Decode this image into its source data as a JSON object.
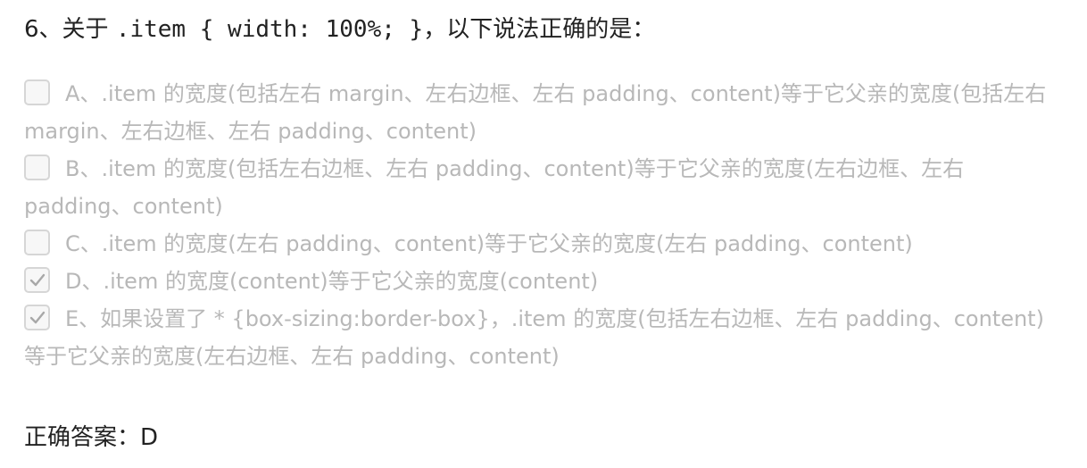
{
  "question": {
    "prefix": "6、关于 ",
    "code": ".item { width: 100%; }",
    "suffix": "，以下说法正确的是："
  },
  "options": [
    {
      "checked": false,
      "text": "A、.item 的宽度(包括左右 margin、左右边框、左右 padding、content)等于它父亲的宽度(包括左右 margin、左右边框、左右 padding、content)"
    },
    {
      "checked": false,
      "text": "B、.item 的宽度(包括左右边框、左右 padding、content)等于它父亲的宽度(左右边框、左右 padding、content)"
    },
    {
      "checked": false,
      "text": "C、.item 的宽度(左右 padding、content)等于它父亲的宽度(左右 padding、content)"
    },
    {
      "checked": true,
      "text": "D、.item 的宽度(content)等于它父亲的宽度(content)"
    },
    {
      "checked": true,
      "text": "E、如果设置了 * {box-sizing:border-box}，.item 的宽度(包括左右边框、左右 padding、content)等于它父亲的宽度(左右边框、左右 padding、content)"
    }
  ],
  "answer": {
    "label": "正确答案：D"
  },
  "colors": {
    "question_text": "#222222",
    "option_text": "#b8b8b8",
    "checkbox_border": "#d6d6d6",
    "checkmark": "#a8a8a8"
  }
}
